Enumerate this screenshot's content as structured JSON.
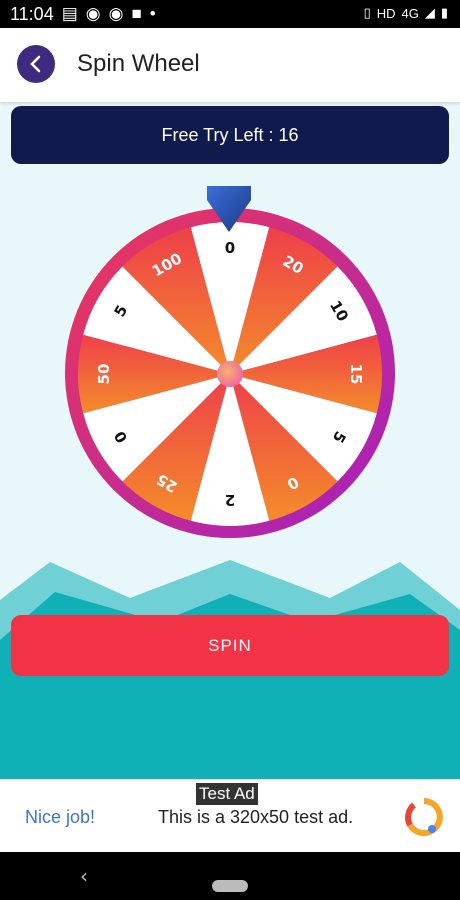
{
  "status_bar": {
    "time": "11:04",
    "network": "HD",
    "signal": "4G"
  },
  "app_bar": {
    "title": "Spin Wheel"
  },
  "banner": {
    "text": "Free Try Left : 16"
  },
  "wheel": {
    "segments": [
      "0",
      "20",
      "10",
      "15",
      "5",
      "0",
      "2",
      "25",
      "0",
      "50",
      "5",
      "100"
    ],
    "colors": {
      "rim_start": "#e8305a",
      "rim_end": "#a21fc2",
      "orange_start": "#ee3f4a",
      "orange_end": "#f28a2c",
      "pointer": "#2e4fa8",
      "hub": "#f4a36b"
    }
  },
  "spin_button": {
    "label": "SPIN"
  },
  "ad": {
    "tag": "Test Ad",
    "headline": "Nice job!",
    "body": "This is a 320x50 test ad."
  },
  "theme": {
    "teal": "#10b0b7",
    "teal_light": "#55c7cd",
    "navy": "#101a4d",
    "red": "#f23346",
    "purple": "#3e2a7e"
  }
}
